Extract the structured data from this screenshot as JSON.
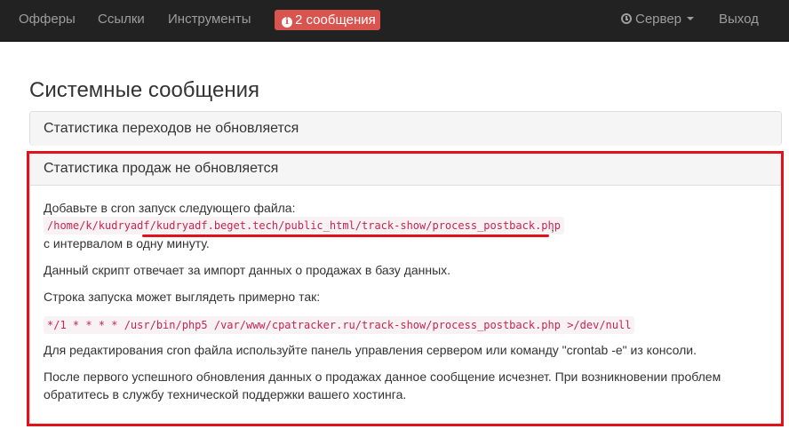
{
  "navbar": {
    "offers": "Офферы",
    "links": "Ссылки",
    "tools": "Инструменты",
    "messages": "2 сообщения",
    "server": "Сервер",
    "logout": "Выход"
  },
  "page": {
    "title": "Системные сообщения"
  },
  "panels": [
    {
      "heading": "Статистика переходов не обновляется"
    },
    {
      "heading": "Статистика продаж не обновляется",
      "body": {
        "line1": "Добавьте в cron запуск следующего файла:",
        "file_path": "/home/k/kudryadf/kudryadf.beget.tech/public_html/track-show/process_postback.php",
        "comma": ",",
        "line2": "с интервалом в одну минуту.",
        "para2": "Данный скрипт отвечает за импорт данных о продажах в базу данных.",
        "para3": "Строка запуска может выглядеть примерно так:",
        "cron_line": "*/1 * * * * /usr/bin/php5 /var/www/cpatracker.ru/track-show/process_postback.php >/dev/null",
        "para4": "Для редактирования cron файла используйте панель управления сервером или команду \"crontab -e\" из консоли.",
        "para5_line1": "После первого успешного обновления данных о продажах данное сообщение исчезнет. При возникновении проблем",
        "para5_line2": "обратитесь в службу технической поддержки вашего хостинга."
      }
    }
  ],
  "colors": {
    "navbar_bg": "#222222",
    "badge_bg": "#d9534f",
    "code_text": "#c7254e",
    "annotation_red": "#e0131c"
  },
  "icons": {
    "messages": "info-circle-icon",
    "server": "clock-icon",
    "dropdown": "caret-down-icon"
  }
}
